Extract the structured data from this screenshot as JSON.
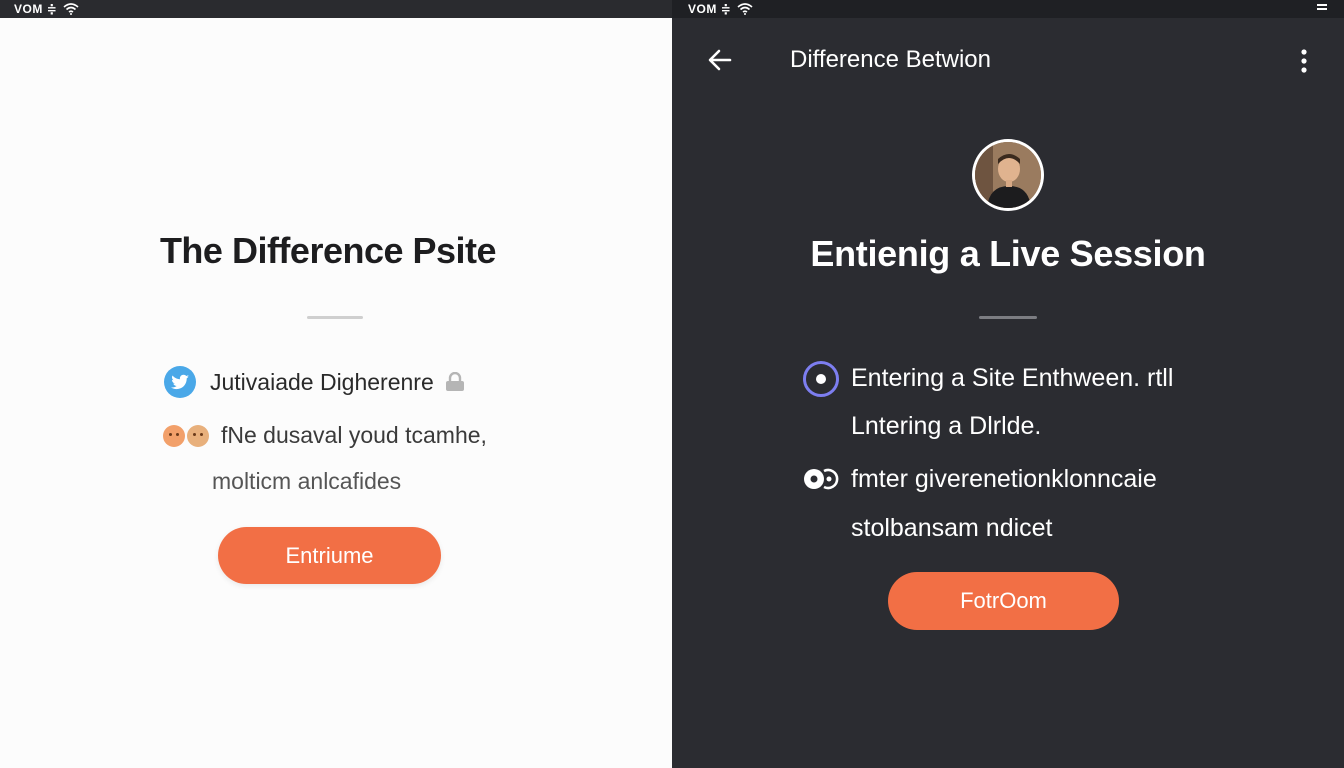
{
  "left": {
    "status_text": "VOM ≑",
    "title": "The Difference Psite",
    "row1": {
      "icon": "twitter-bird-icon",
      "text": "Jutivaiade Digherenre"
    },
    "row2": {
      "icon": "emoji-faces-icon",
      "text": "fNe dusaval youd tcamhe,"
    },
    "row3": {
      "text": "molticm anlcafides"
    },
    "button_label": "Entriume"
  },
  "right": {
    "status_text": "VOM ≑",
    "appbar": {
      "back_icon": "arrow-left-icon",
      "title": "Difference Betwion",
      "menu_icon": "kebab-menu-icon"
    },
    "title": "Entienig a Live Session",
    "items": [
      {
        "icon": "radio-selected-icon",
        "line1": "Entering a Site Enthween. rtll",
        "line2": "Lntering a Dlrlde."
      },
      {
        "icon": "dual-circle-icon",
        "line1": "fmter giverenetionklonncaie",
        "line2": "stolbansam ndicet"
      }
    ],
    "button_label": "FotrOom"
  },
  "colors": {
    "accent": "#f26f45",
    "radio": "#7d7ef0",
    "dark_bg": "#2b2c31",
    "light_bg": "#fcfcfc"
  }
}
